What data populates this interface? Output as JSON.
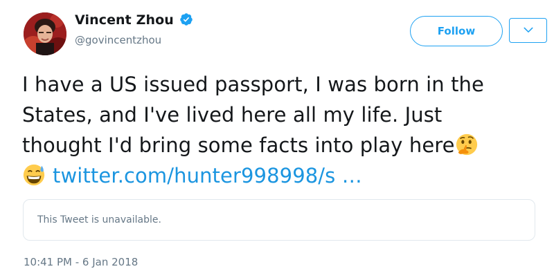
{
  "author": {
    "display_name": "Vincent Zhou",
    "handle": "@govincentzhou",
    "verified": true
  },
  "actions": {
    "follow_label": "Follow"
  },
  "tweet": {
    "line1": "I have a US issued passport, I was born in the",
    "line2": "States, and I've lived here all my life. Just",
    "line3": "thought I'd bring some facts into play here",
    "link_text": "twitter.com/hunter998998/s …",
    "emojis": [
      "thinking-face",
      "grinning-face-with-sweat"
    ]
  },
  "quoted_tweet": {
    "text": "This Tweet is unavailable."
  },
  "timestamp": "10:41 PM - 6 Jan 2018",
  "colors": {
    "accent": "#1da1f2",
    "link": "#1b95e0",
    "text": "#14171a",
    "secondary": "#657786",
    "border": "#e1e8ed"
  }
}
